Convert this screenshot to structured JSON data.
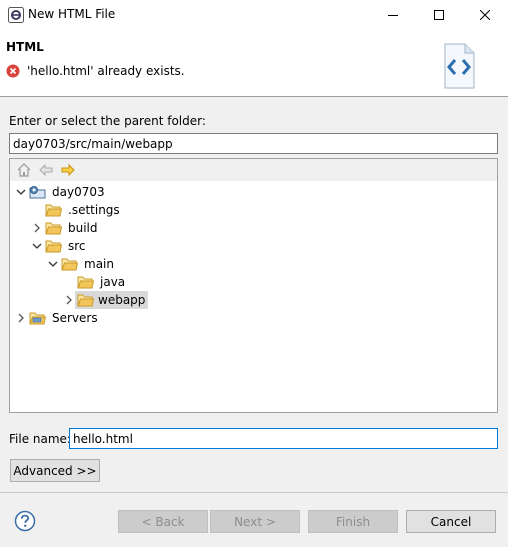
{
  "window": {
    "title": "New HTML File"
  },
  "header": {
    "title": "HTML",
    "error_message": "'hello.html' already exists."
  },
  "parent_folder": {
    "label": "Enter or select the parent folder:",
    "value": "day0703/src/main/webapp"
  },
  "tree": {
    "toolbar": [
      "home-icon",
      "back-arrow-icon",
      "forward-arrow-icon"
    ],
    "items": [
      {
        "label": "day0703",
        "expanded": true,
        "type": "project"
      },
      {
        "label": ".settings",
        "expanded": false,
        "type": "folder"
      },
      {
        "label": "build",
        "expanded": false,
        "type": "folder"
      },
      {
        "label": "src",
        "expanded": true,
        "type": "folder"
      },
      {
        "label": "main",
        "expanded": true,
        "type": "folder"
      },
      {
        "label": "java",
        "expanded": false,
        "type": "folder"
      },
      {
        "label": "webapp",
        "expanded": false,
        "type": "folder",
        "selected": true
      },
      {
        "label": "Servers",
        "expanded": false,
        "type": "folder"
      }
    ]
  },
  "file_name": {
    "label": "File name:",
    "value": "hello.html"
  },
  "buttons": {
    "advanced": "Advanced >>",
    "back": "< Back",
    "next": "Next >",
    "finish": "Finish",
    "cancel": "Cancel"
  },
  "colors": {
    "accent": "#0078d7",
    "error": "#d9443c",
    "folder": "#f3c65b",
    "selection": "#d9d9d9"
  }
}
